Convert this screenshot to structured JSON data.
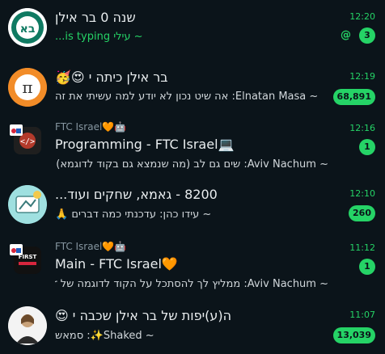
{
  "chats": [
    {
      "title": "שנה 0 בר אילן",
      "preview": "~ עילי is typing...",
      "time": "12:20",
      "unread": "3",
      "mention": "@",
      "avatar_text": "בא",
      "title_emoji": ""
    },
    {
      "title": "בר אילן כיתה י",
      "title_emoji": "😍🥳",
      "preview": "~ Elnatan Masa: אה שיט  נכון לא יודע למה עשיתי את זה",
      "time": "12:19",
      "unread": "68,891"
    },
    {
      "subtitle": "FTC Israel🧡🤖",
      "title": "Programming - FTC Israel💻",
      "preview": "~ Aviv Nachum: שים גם לב (מה שנמצא גם בקוד לדוגמא) שיש פקודה שצ...",
      "time": "12:16",
      "unread": "1"
    },
    {
      "title": "8200 - גאמא, שחקים ועוד...",
      "preview": "~ עידו כהן: עדכנתי כמה דברים 🙏",
      "time": "12:10",
      "unread": "260"
    },
    {
      "subtitle": "FTC Israel🧡🤖",
      "title": "Main - FTC Israel🧡",
      "preview": "~ Aviv Nachum: ממליץ לך להסתכל על הקוד לדוגמה של robotcontroller...",
      "time": "11:12",
      "unread": "1"
    },
    {
      "title": "ה(ע)יפות של בר אילן שכבה י",
      "title_emoji": "😍",
      "preview": "~ Shaked✨: סמאש",
      "time": "11:07",
      "unread": "13,039"
    }
  ],
  "colors": {
    "background": "#0b141a",
    "accent": "#25d366",
    "text": "#e9edef",
    "muted": "#8696a0"
  }
}
